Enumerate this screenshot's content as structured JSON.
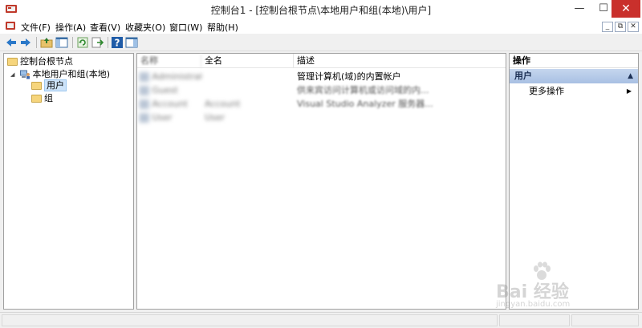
{
  "window": {
    "title": "控制台1 - [控制台根节点\\本地用户和组(本地)\\用户]",
    "controls": {
      "minimize": "—",
      "maximize": "☐",
      "close": "✕"
    }
  },
  "menubar": {
    "items": [
      "文件(F)",
      "操作(A)",
      "查看(V)",
      "收藏夹(O)",
      "窗口(W)",
      "帮助(H)"
    ],
    "mdi_controls": [
      "_",
      "⧉",
      "✕"
    ]
  },
  "toolbar": {
    "icons": [
      "back-arrow-icon",
      "forward-arrow-icon",
      "up-folder-icon",
      "show-hide-tree-icon",
      "refresh-icon",
      "export-list-icon",
      "help-icon",
      "show-hide-action-pane-icon"
    ]
  },
  "tree": {
    "root": "控制台根节点",
    "local": "本地用户和组(本地)",
    "users": "用户",
    "groups": "组",
    "expander": "◢"
  },
  "list": {
    "columns": [
      "名称",
      "全名",
      "描述"
    ],
    "rows": [
      {
        "name": "Administrator",
        "fullname": "",
        "desc": "管理计算机(域)的内置帐户"
      },
      {
        "name": "Guest",
        "fullname": "",
        "desc": "供来宾访问计算机或访问域的内..."
      },
      {
        "name": "Account",
        "fullname": "Account",
        "desc": "Visual Studio Analyzer 服务器..."
      },
      {
        "name": "User",
        "fullname": "User",
        "desc": ""
      }
    ]
  },
  "actions": {
    "title": "操作",
    "section": "用户",
    "collapse_glyph": "▲",
    "item": "更多操作",
    "item_arrow": "▶"
  },
  "watermark": {
    "brand": "Bai 经验",
    "url": "jingyan.baidu.com"
  },
  "colors": {
    "section_header": "#b4c8e8",
    "close_button": "#c9302c",
    "selection": "#cde3f9"
  }
}
